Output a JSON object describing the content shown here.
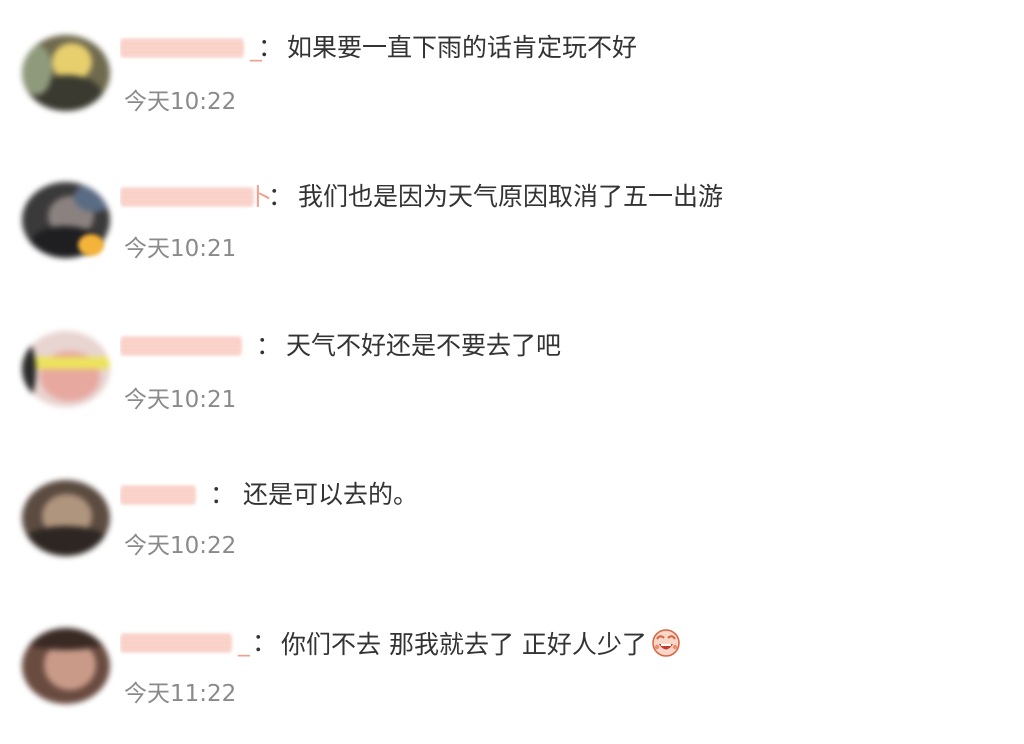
{
  "comments": [
    {
      "name_tail": "_",
      "text": "如果要一直下雨的话肯定玩不好",
      "time": "今天10:22"
    },
    {
      "name_tail": "卜",
      "text": "我们也是因为天气原因取消了五一出游",
      "time": "今天10:21"
    },
    {
      "name_tail": "",
      "text": "天气不好还是不要去了吧",
      "time": "今天10:21"
    },
    {
      "name_tail": "",
      "text": "还是可以去的。",
      "time": "今天10:22"
    },
    {
      "name_tail": "_",
      "text": "你们不去 那我就去了 正好人少了",
      "time": "今天11:22",
      "emoji": "laughing-emoji-icon"
    }
  ],
  "separator": "："
}
